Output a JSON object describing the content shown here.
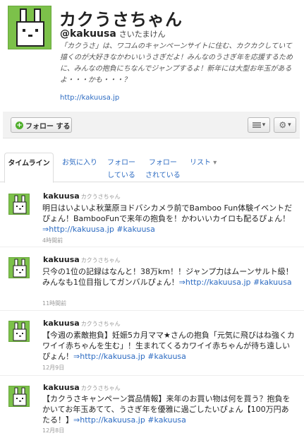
{
  "profile": {
    "name": "カクうさちゃん",
    "screen_name": "@kakuusa",
    "screen_name_sub": "さいたまけん",
    "bio": "「カクうさ」は、ワコムのキャンペーンサイトに住む、カクカクしていて描くのが大好きなかわいいうさぎだよ！みんなのうさぎ年を応援するために、みんなの抱負にちなんでジャンプするよ！新年には大型お年玉があるよ・・・かも・・・？",
    "url": "http://kakuusa.jp"
  },
  "actions": {
    "follow_label": "フォロー する",
    "list_icon": "list-icon",
    "gear_icon": "gear-icon"
  },
  "tabs": {
    "timeline": "タイムライン",
    "favorites": "お気に入り",
    "following_1": "フォロー",
    "following_2": "している",
    "followers_1": "フォロー",
    "followers_2": "されている",
    "lists": "リスト"
  },
  "tweets": [
    {
      "user": "kakuusa",
      "user_sub": "カクうさちゃん",
      "text_1": "明日はいよいよ秋葉原ヨドバシカメラ前でBamboo Fun体験イベントだぴょん！BambooFunで来年の抱負を！かわいいカイロも配るぴょん！",
      "link": "⇒http://kakuusa.jp #kakuusa",
      "time": "4時間前"
    },
    {
      "user": "kakuusa",
      "user_sub": "カクうさちゃん",
      "text_1": "只今の1位の記録はなんと！38万km！！ジャンプ力はムーンサルト級！みんなも1位目指してガンバルぴょん！",
      "link": "⇒http://kakuusa.jp #kakuusa",
      "time": "11時間前"
    },
    {
      "user": "kakuusa",
      "user_sub": "カクうさちゃん",
      "text_1": "【今週の素敵抱負】妊娠5カ月ママ★さんの抱負「元気に飛びはね強くカワイイ赤ちゃんを生む」！生まれてくるカワイイ赤ちゃんが待ち遠しいぴょん！",
      "link": "⇒http://kakuusa.jp #kakuusa",
      "time": "12月9日"
    },
    {
      "user": "kakuusa",
      "user_sub": "カクうさちゃん",
      "text_1": "【カクうさキャンペーン賞品情報】来年のお買い物は何を買う？抱負をかいてお年玉あてて、うさぎ年を優雅に過ごしたいぴょん【100万円あたる！】",
      "link": "⇒http://kakuusa.jp #kakuusa",
      "time": "12月8日"
    }
  ],
  "colors": {
    "link": "#2b6ac1",
    "avatar": "#7cc14a"
  }
}
